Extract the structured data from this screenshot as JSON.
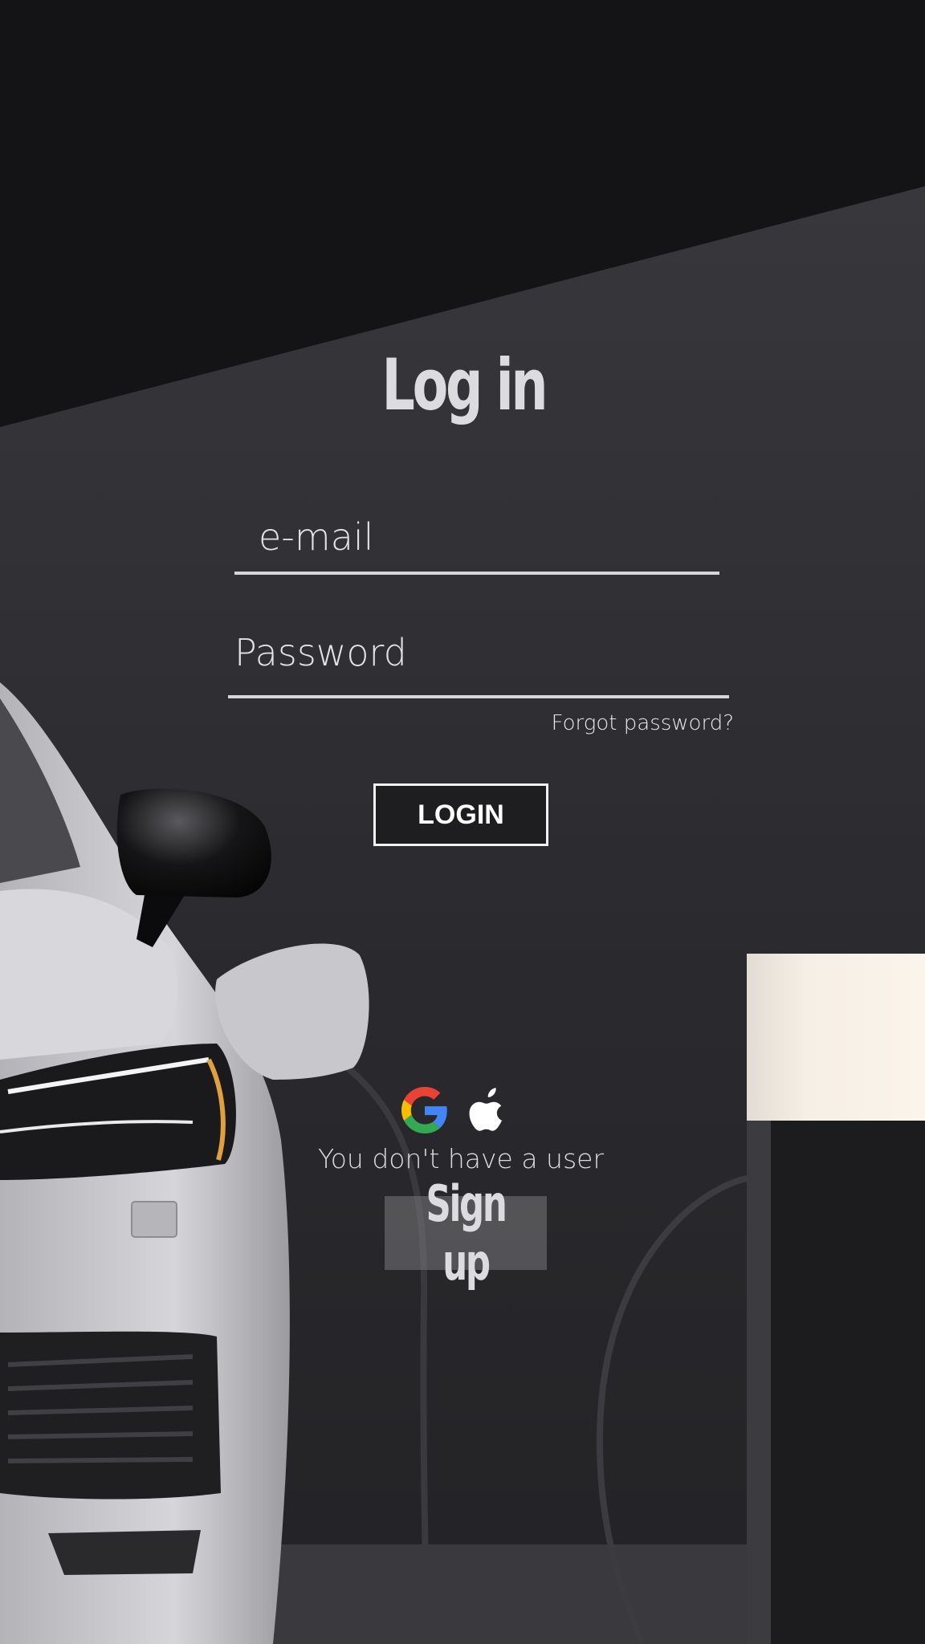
{
  "screen": {
    "title": "Log in"
  },
  "form": {
    "email_placeholder": "e-mail",
    "email_value": "",
    "password_placeholder": "Password",
    "password_value": "",
    "forgot_password_label": "Forgot password?",
    "login_label": "LOGIN"
  },
  "social": {
    "providers": [
      {
        "name": "Google",
        "icon": "google-icon"
      },
      {
        "name": "Apple",
        "icon": "apple-icon"
      }
    ]
  },
  "signup": {
    "prompt": "You don't have a user",
    "button_label": "Sign up"
  },
  "colors": {
    "background_dark": "#151518",
    "wall": "#2f2f33",
    "text_light": "#dcdcdf",
    "button_border": "#f2f2f2",
    "signup_bg": "#6a6a6e",
    "car_white": "#c9c9cc",
    "lamp_glow": "#f1ece4"
  },
  "background": {
    "image_subject": "white-electric-car-charging-scene"
  }
}
